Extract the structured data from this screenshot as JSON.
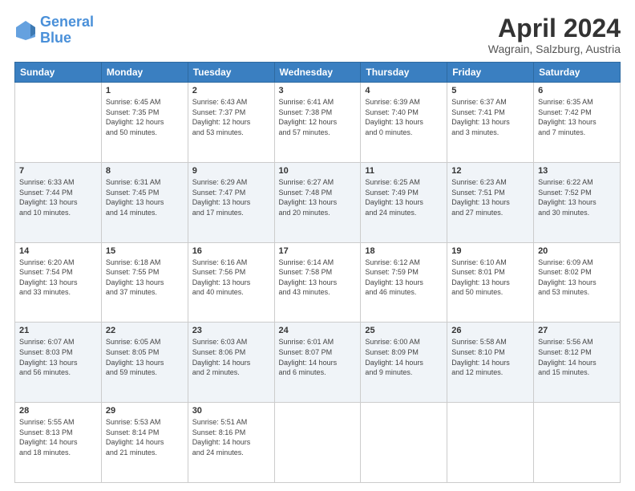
{
  "header": {
    "logo_line1": "General",
    "logo_line2": "Blue",
    "month": "April 2024",
    "location": "Wagrain, Salzburg, Austria"
  },
  "weekdays": [
    "Sunday",
    "Monday",
    "Tuesday",
    "Wednesday",
    "Thursday",
    "Friday",
    "Saturday"
  ],
  "weeks": [
    [
      {
        "day": "",
        "info": ""
      },
      {
        "day": "1",
        "info": "Sunrise: 6:45 AM\nSunset: 7:35 PM\nDaylight: 12 hours\nand 50 minutes."
      },
      {
        "day": "2",
        "info": "Sunrise: 6:43 AM\nSunset: 7:37 PM\nDaylight: 12 hours\nand 53 minutes."
      },
      {
        "day": "3",
        "info": "Sunrise: 6:41 AM\nSunset: 7:38 PM\nDaylight: 12 hours\nand 57 minutes."
      },
      {
        "day": "4",
        "info": "Sunrise: 6:39 AM\nSunset: 7:40 PM\nDaylight: 13 hours\nand 0 minutes."
      },
      {
        "day": "5",
        "info": "Sunrise: 6:37 AM\nSunset: 7:41 PM\nDaylight: 13 hours\nand 3 minutes."
      },
      {
        "day": "6",
        "info": "Sunrise: 6:35 AM\nSunset: 7:42 PM\nDaylight: 13 hours\nand 7 minutes."
      }
    ],
    [
      {
        "day": "7",
        "info": "Sunrise: 6:33 AM\nSunset: 7:44 PM\nDaylight: 13 hours\nand 10 minutes."
      },
      {
        "day": "8",
        "info": "Sunrise: 6:31 AM\nSunset: 7:45 PM\nDaylight: 13 hours\nand 14 minutes."
      },
      {
        "day": "9",
        "info": "Sunrise: 6:29 AM\nSunset: 7:47 PM\nDaylight: 13 hours\nand 17 minutes."
      },
      {
        "day": "10",
        "info": "Sunrise: 6:27 AM\nSunset: 7:48 PM\nDaylight: 13 hours\nand 20 minutes."
      },
      {
        "day": "11",
        "info": "Sunrise: 6:25 AM\nSunset: 7:49 PM\nDaylight: 13 hours\nand 24 minutes."
      },
      {
        "day": "12",
        "info": "Sunrise: 6:23 AM\nSunset: 7:51 PM\nDaylight: 13 hours\nand 27 minutes."
      },
      {
        "day": "13",
        "info": "Sunrise: 6:22 AM\nSunset: 7:52 PM\nDaylight: 13 hours\nand 30 minutes."
      }
    ],
    [
      {
        "day": "14",
        "info": "Sunrise: 6:20 AM\nSunset: 7:54 PM\nDaylight: 13 hours\nand 33 minutes."
      },
      {
        "day": "15",
        "info": "Sunrise: 6:18 AM\nSunset: 7:55 PM\nDaylight: 13 hours\nand 37 minutes."
      },
      {
        "day": "16",
        "info": "Sunrise: 6:16 AM\nSunset: 7:56 PM\nDaylight: 13 hours\nand 40 minutes."
      },
      {
        "day": "17",
        "info": "Sunrise: 6:14 AM\nSunset: 7:58 PM\nDaylight: 13 hours\nand 43 minutes."
      },
      {
        "day": "18",
        "info": "Sunrise: 6:12 AM\nSunset: 7:59 PM\nDaylight: 13 hours\nand 46 minutes."
      },
      {
        "day": "19",
        "info": "Sunrise: 6:10 AM\nSunset: 8:01 PM\nDaylight: 13 hours\nand 50 minutes."
      },
      {
        "day": "20",
        "info": "Sunrise: 6:09 AM\nSunset: 8:02 PM\nDaylight: 13 hours\nand 53 minutes."
      }
    ],
    [
      {
        "day": "21",
        "info": "Sunrise: 6:07 AM\nSunset: 8:03 PM\nDaylight: 13 hours\nand 56 minutes."
      },
      {
        "day": "22",
        "info": "Sunrise: 6:05 AM\nSunset: 8:05 PM\nDaylight: 13 hours\nand 59 minutes."
      },
      {
        "day": "23",
        "info": "Sunrise: 6:03 AM\nSunset: 8:06 PM\nDaylight: 14 hours\nand 2 minutes."
      },
      {
        "day": "24",
        "info": "Sunrise: 6:01 AM\nSunset: 8:07 PM\nDaylight: 14 hours\nand 6 minutes."
      },
      {
        "day": "25",
        "info": "Sunrise: 6:00 AM\nSunset: 8:09 PM\nDaylight: 14 hours\nand 9 minutes."
      },
      {
        "day": "26",
        "info": "Sunrise: 5:58 AM\nSunset: 8:10 PM\nDaylight: 14 hours\nand 12 minutes."
      },
      {
        "day": "27",
        "info": "Sunrise: 5:56 AM\nSunset: 8:12 PM\nDaylight: 14 hours\nand 15 minutes."
      }
    ],
    [
      {
        "day": "28",
        "info": "Sunrise: 5:55 AM\nSunset: 8:13 PM\nDaylight: 14 hours\nand 18 minutes."
      },
      {
        "day": "29",
        "info": "Sunrise: 5:53 AM\nSunset: 8:14 PM\nDaylight: 14 hours\nand 21 minutes."
      },
      {
        "day": "30",
        "info": "Sunrise: 5:51 AM\nSunset: 8:16 PM\nDaylight: 14 hours\nand 24 minutes."
      },
      {
        "day": "",
        "info": ""
      },
      {
        "day": "",
        "info": ""
      },
      {
        "day": "",
        "info": ""
      },
      {
        "day": "",
        "info": ""
      }
    ]
  ]
}
